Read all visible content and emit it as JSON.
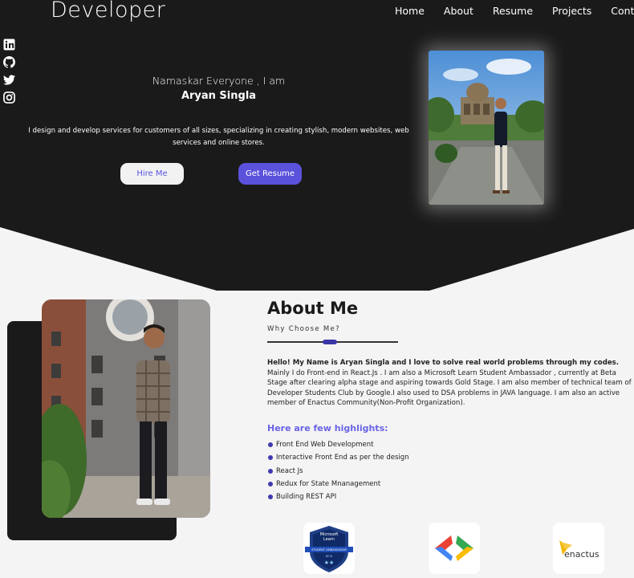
{
  "header": {
    "brand": "Developer",
    "nav": [
      "Home",
      "About",
      "Resume",
      "Projects",
      "Contact"
    ]
  },
  "social": [
    "linkedin-icon",
    "github-icon",
    "twitter-icon",
    "instagram-icon"
  ],
  "hero": {
    "greeting": "Namaskar Everyone , I am",
    "name": "Aryan Singla",
    "intro": "I design and develop services for customers of all sizes, specializing in creating stylish, modern websites, web services and online stores.",
    "hire_button": "Hire Me",
    "resume_button": "Get Resume"
  },
  "about": {
    "title": "About Me",
    "subtitle": "Why Choose Me?",
    "bio_lead": "Hello! My Name is Aryan Singla and I love to solve real world problems through my codes.",
    "bio_rest": "Mainly I do Front-end in React.Js . I am also a Microsoft Learn Student Ambassador , currently at Beta Stage after clearing alpha stage and aspiring towards Gold Stage. I am also member of technical team of Developer Students Club by Google.I also used to DSA problems in JAVA language. I am also an active member of Enactus Community(Non-Profit Organization).",
    "highlights_title": "Here are few highlights:",
    "highlights": [
      "Front End Web Development",
      "Interactive Front End as per the design",
      "React Js",
      "Redux for State Mnanagement",
      "Building REST API"
    ]
  },
  "badges": {
    "microsoft_line1": "Microsoft",
    "microsoft_line2": "Learn",
    "microsoft_ribbon": "STUDENT AMBASSADOR",
    "microsoft_stage": "BETA",
    "enactus": "enactus"
  },
  "colors": {
    "accent": "#5b52dc",
    "dark": "#1a1a1a",
    "highlight_title": "#6a63e6"
  }
}
